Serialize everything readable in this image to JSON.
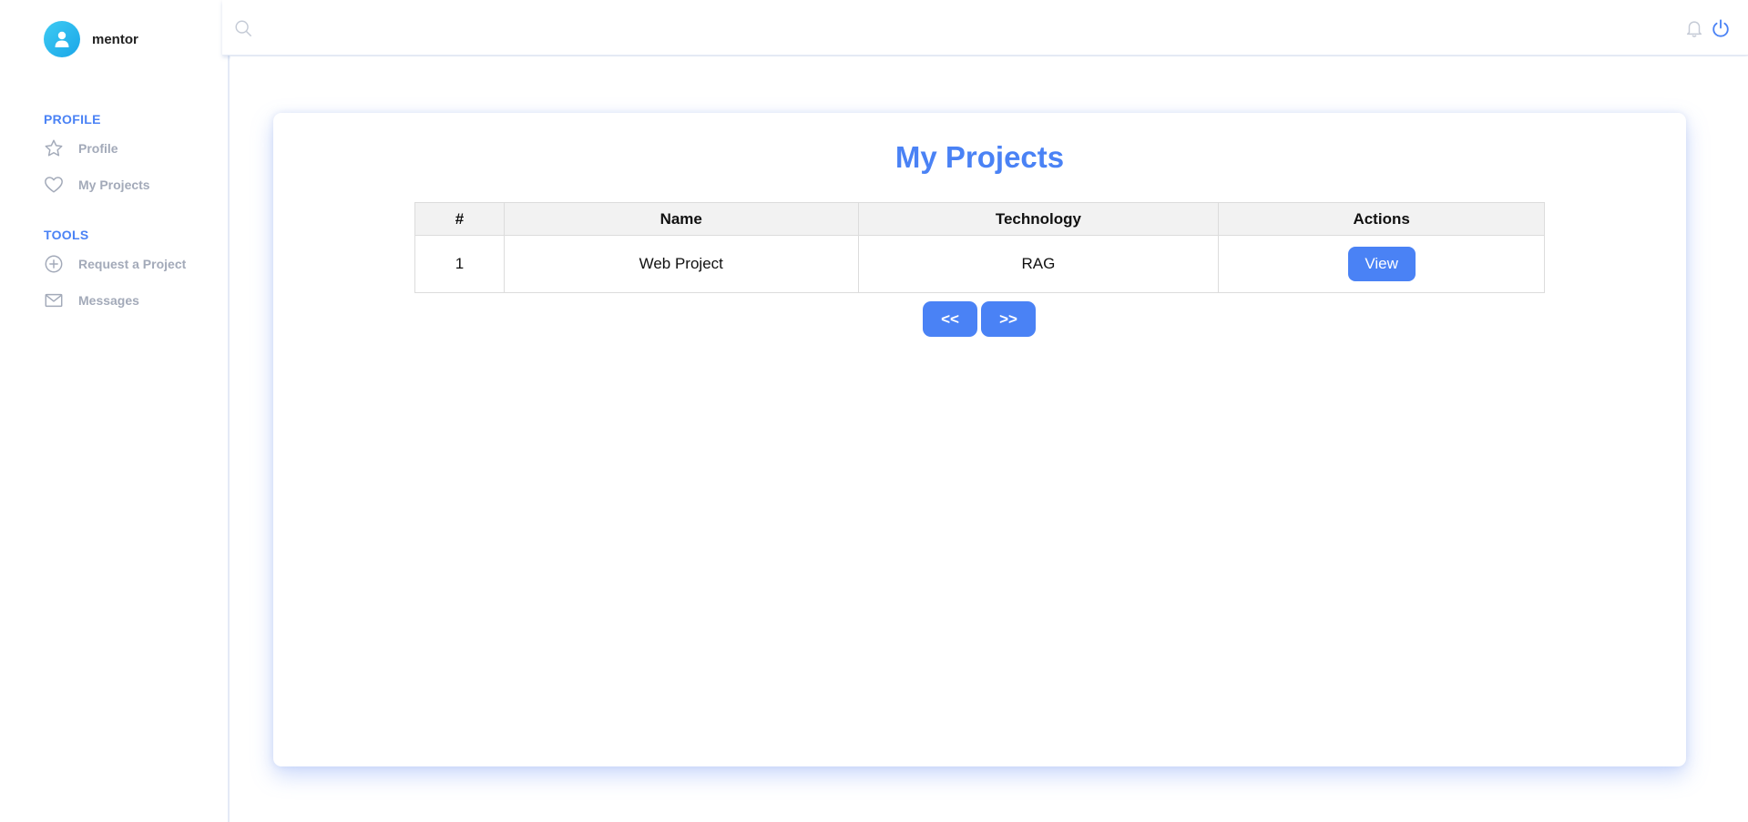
{
  "user": {
    "name": "mentor",
    "avatar_icon": "user-icon"
  },
  "sidebar": {
    "sections": [
      {
        "title": "PROFILE",
        "items": [
          {
            "label": "Profile",
            "icon": "star-icon"
          },
          {
            "label": "My Projects",
            "icon": "heart-icon"
          }
        ]
      },
      {
        "title": "TOOLS",
        "items": [
          {
            "label": "Request a Project",
            "icon": "plus-circle-icon"
          },
          {
            "label": "Messages",
            "icon": "mail-icon"
          }
        ]
      }
    ]
  },
  "topbar": {
    "icons": [
      "search-icon",
      "bell-icon",
      "power-icon"
    ]
  },
  "main": {
    "title": "My Projects",
    "table": {
      "columns": [
        "#",
        "Name",
        "Technology",
        "Actions"
      ],
      "rows": [
        {
          "index": "1",
          "name": "Web Project",
          "technology": "RAG",
          "action_label": "View"
        }
      ]
    },
    "pagination": {
      "prev_label": "<<",
      "next_label": ">>"
    }
  },
  "colors": {
    "accent": "#4a82f5",
    "avatar": "#1aa6e8",
    "muted": "#a3aab9"
  }
}
